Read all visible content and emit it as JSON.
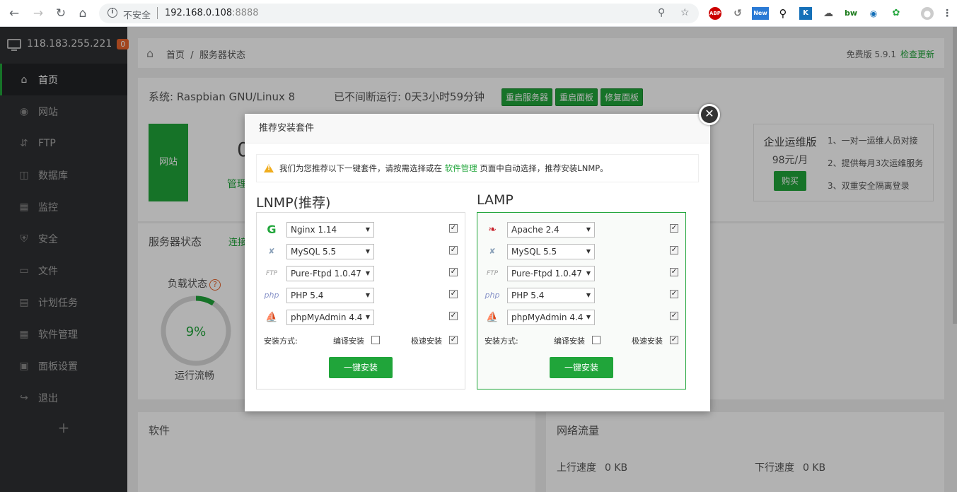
{
  "browser": {
    "insecure_label": "不安全",
    "url_host": "192.168.0.108",
    "url_port": ":8888"
  },
  "sidebar": {
    "server_ip": "118.183.255.221",
    "badge": "0",
    "items": [
      {
        "label": "首页",
        "icon": "home-icon"
      },
      {
        "label": "网站",
        "icon": "globe-icon"
      },
      {
        "label": "FTP",
        "icon": "ftp-icon"
      },
      {
        "label": "数据库",
        "icon": "database-icon"
      },
      {
        "label": "监控",
        "icon": "monitor-icon"
      },
      {
        "label": "安全",
        "icon": "shield-icon"
      },
      {
        "label": "文件",
        "icon": "folder-icon"
      },
      {
        "label": "计划任务",
        "icon": "calendar-icon"
      },
      {
        "label": "软件管理",
        "icon": "grid-icon"
      },
      {
        "label": "面板设置",
        "icon": "settings-icon"
      },
      {
        "label": "退出",
        "icon": "logout-icon"
      }
    ],
    "add": "+"
  },
  "breadcrumb": {
    "home": "首页",
    "sep": "/",
    "current": "服务器状态",
    "version": "免费版 5.9.1",
    "update": "检查更新"
  },
  "system": {
    "os": "系统: Raspbian GNU/Linux 8",
    "uptime": "已不间断运行: 0天3小时59分钟",
    "btn_restart_server": "重启服务器",
    "btn_restart_panel": "重启面板",
    "btn_repair_panel": "修复面板",
    "site_label": "网站",
    "site_count": "0",
    "site_link": "管理"
  },
  "enterprise": {
    "title": "企业运维版",
    "price": "98元/月",
    "buy": "购买",
    "features": [
      "1、一对一运维人员对接",
      "2、提供每月3次运维服务",
      "3、双重安全隔离登录"
    ]
  },
  "status": {
    "title": "服务器状态",
    "link": "连接",
    "load_label": "负载状态",
    "help": "?",
    "load_value": "9%",
    "load_fraction": 0.09,
    "load_text": "运行流畅"
  },
  "software": {
    "title": "软件"
  },
  "network": {
    "title": "网络流量",
    "up_label": "上行速度",
    "up_value": "0 KB",
    "down_label": "下行速度",
    "down_value": "0 KB"
  },
  "modal": {
    "title": "推荐安装套件",
    "notice_before": "我们为您推荐以下一键套件，请按需选择或在",
    "notice_link": "软件管理",
    "notice_after": "页面中自动选择，推荐安装LNMP。",
    "lnmp": {
      "title": "LNMP(推荐)",
      "rows": [
        {
          "icon": "nginx-icon",
          "value": "Nginx 1.14",
          "checked": true
        },
        {
          "icon": "mysql-icon",
          "value": "MySQL 5.5",
          "checked": true
        },
        {
          "icon": "ftp-icon",
          "value": "Pure-Ftpd 1.0.47",
          "checked": true
        },
        {
          "icon": "php-icon",
          "value": "PHP 5.4",
          "checked": true
        },
        {
          "icon": "phpmyadmin-icon",
          "value": "phpMyAdmin 4.4",
          "checked": true
        }
      ],
      "mode_label": "安装方式:",
      "compile_label": "编译安装",
      "compile_checked": false,
      "fast_label": "极速安装",
      "fast_checked": true,
      "install": "一键安装"
    },
    "lamp": {
      "title": "LAMP",
      "rows": [
        {
          "icon": "apache-icon",
          "value": "Apache 2.4",
          "checked": true
        },
        {
          "icon": "mysql-icon",
          "value": "MySQL 5.5",
          "checked": true
        },
        {
          "icon": "ftp-icon",
          "value": "Pure-Ftpd 1.0.47",
          "checked": true
        },
        {
          "icon": "php-icon",
          "value": "PHP 5.4",
          "checked": true
        },
        {
          "icon": "phpmyadmin-icon",
          "value": "phpMyAdmin 4.4",
          "checked": true
        }
      ],
      "mode_label": "安装方式:",
      "compile_label": "编译安装",
      "compile_checked": false,
      "fast_label": "极速安装",
      "fast_checked": true,
      "install": "一键安装"
    }
  },
  "colors": {
    "accent": "#20a53a",
    "sidebar": "#2f3033",
    "badge": "#e8632b"
  }
}
